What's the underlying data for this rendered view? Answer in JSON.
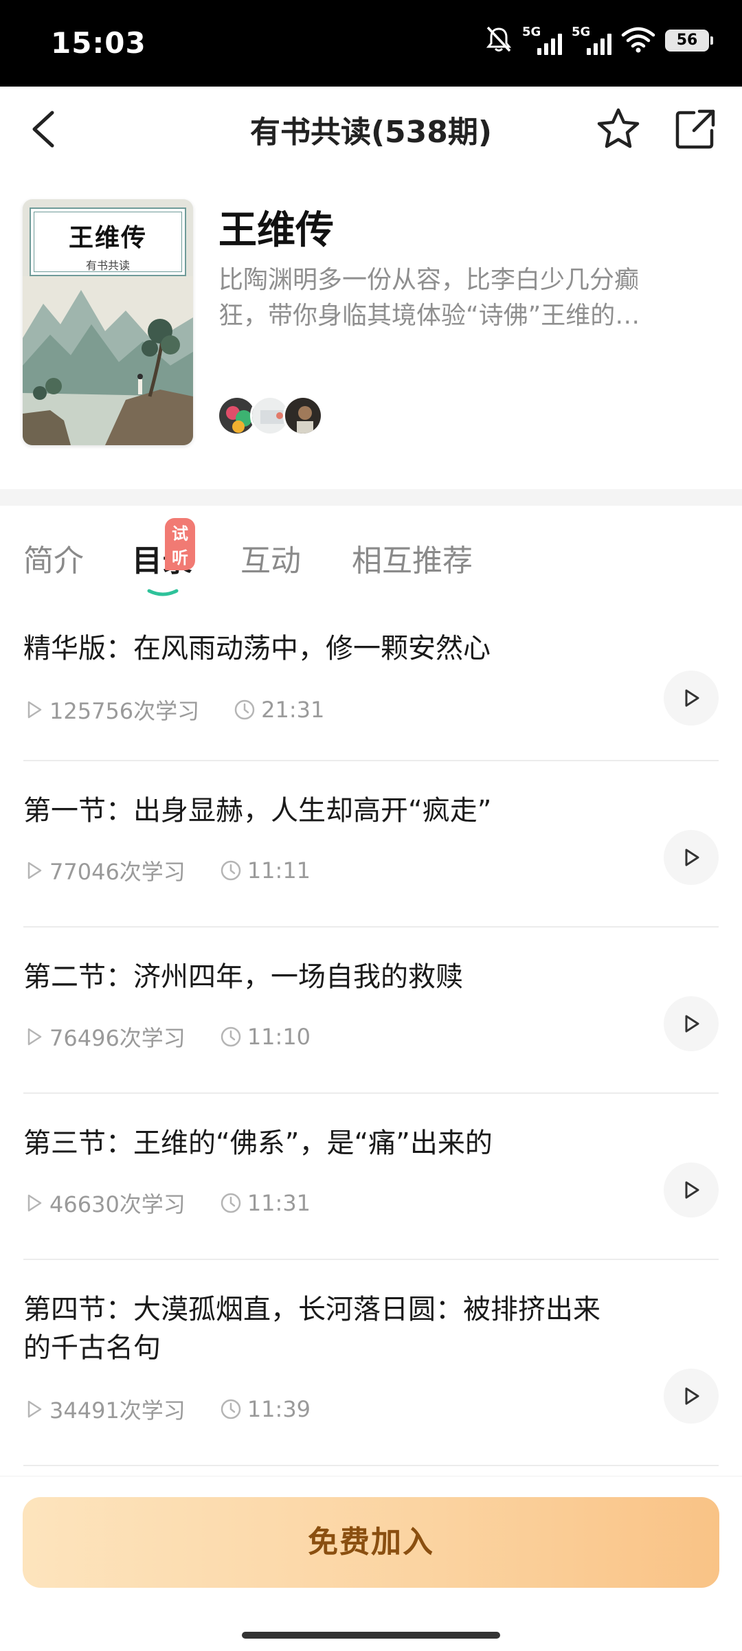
{
  "status_bar": {
    "time": "15:03",
    "network_1": "5G",
    "network_2": "5G",
    "battery": "56",
    "icons": [
      "mute-bell-icon",
      "signal-icon",
      "signal-icon",
      "wifi-icon",
      "battery-icon"
    ]
  },
  "nav": {
    "title": "有书共读(538期)",
    "back_icon": "chevron-left-icon",
    "favorite_icon": "star-icon",
    "share_icon": "share-icon"
  },
  "book": {
    "cover_title": "王维传",
    "cover_subtitle": "有书共读",
    "title": "王维传",
    "description_line1": "比陶渊明多一份从容，比李白少几分癫",
    "description_line2": "狂，带你身临其境体验“诗佛”王维的…",
    "avatar_count": 3
  },
  "tabs": {
    "items": [
      {
        "label": "简介",
        "active": false
      },
      {
        "label": "目录",
        "active": true,
        "badge": "试听"
      },
      {
        "label": "互动",
        "active": false
      },
      {
        "label": "相互推荐",
        "active": false
      }
    ],
    "accent_color": "#2ec29a"
  },
  "chapters": [
    {
      "title_line1": "精华版：在风雨动荡中，修一颗安然心",
      "title_line2": "",
      "plays": "125756次学习",
      "duration": "21:31"
    },
    {
      "title_line1": "第一节：出身显赫，人生却高开“疯走”",
      "title_line2": "",
      "plays": "77046次学习",
      "duration": "11:11"
    },
    {
      "title_line1": "第二节：济州四年，一场自我的救赎",
      "title_line2": "",
      "plays": "76496次学习",
      "duration": "11:10"
    },
    {
      "title_line1": "第三节：王维的“佛系”，是“痛”出来的",
      "title_line2": "",
      "plays": "46630次学习",
      "duration": "11:31"
    },
    {
      "title_line1": "第四节：大漠孤烟直，长河落日圆：被排挤出来",
      "title_line2": "的千古名句",
      "plays": "34491次学习",
      "duration": "11:39"
    }
  ],
  "bottom": {
    "join_label": "免费加入",
    "button_color_start": "#fde4bd",
    "button_color_end": "#f9c386",
    "text_color": "#8a4f10"
  }
}
